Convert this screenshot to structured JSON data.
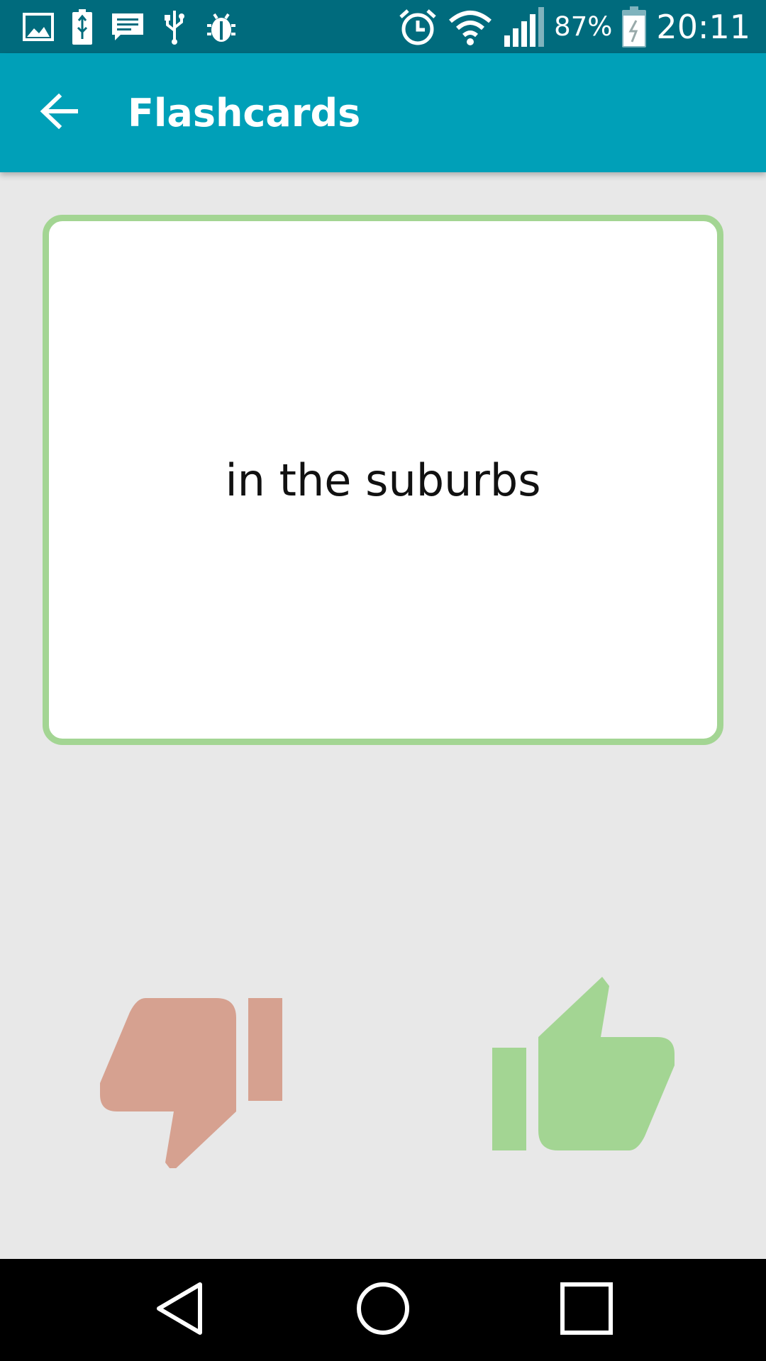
{
  "status_bar": {
    "left_icons": [
      "image-icon",
      "battery-saver-icon",
      "message-icon",
      "usb-icon",
      "bug-icon"
    ],
    "right_icons": [
      "alarm-icon",
      "wifi-icon",
      "signal-icon",
      "battery-charging-icon"
    ],
    "battery_percent": "87%",
    "time": "20:11",
    "background": "#006b7d"
  },
  "app_bar": {
    "back_icon": "arrow-back-icon",
    "title": "Flashcards",
    "background": "#00a0b8"
  },
  "card": {
    "text": "in the suburbs",
    "border_color": "#a3d593"
  },
  "rating": {
    "dislike_icon": "thumb-down-icon",
    "dislike_color": "#d6a190",
    "like_icon": "thumb-up-icon",
    "like_color": "#a3d593"
  },
  "nav_bar": {
    "buttons": [
      "back-triangle-icon",
      "home-circle-icon",
      "recents-square-icon"
    ]
  }
}
